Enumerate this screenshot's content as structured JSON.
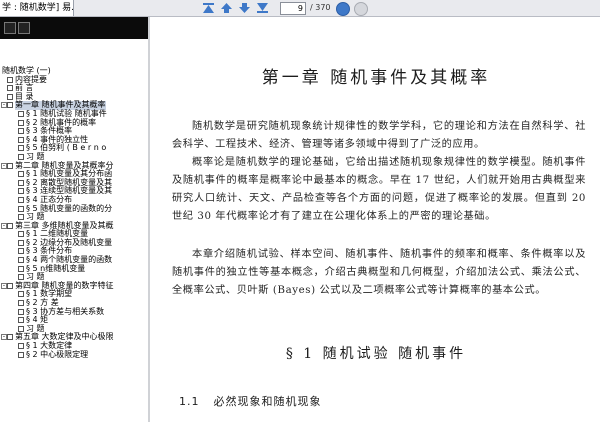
{
  "toolbar": {
    "tab_title": "学 : 随机数学] 易...",
    "current_page": "9",
    "total_pages": "/ 370",
    "buttons": [
      "first-page-icon",
      "prev-page-icon",
      "next-page-icon",
      "last-page-icon"
    ],
    "accent": "#3e78c8"
  },
  "outline": {
    "root": "随机数学 (一)",
    "items": [
      {
        "label": "内容提要",
        "level": 1
      },
      {
        "label": "前      言",
        "level": 1
      },
      {
        "label": "目      录",
        "level": 1
      },
      {
        "label": "第一章  随机事件及其概率",
        "level": 1,
        "expander": true,
        "selected": true
      },
      {
        "label": "§ 1    随机试验   随机事件",
        "level": 2
      },
      {
        "label": "§ 2    随机事件的概率",
        "level": 2
      },
      {
        "label": "§ 3    条件概率",
        "level": 2
      },
      {
        "label": "§ 4    事件的独立性",
        "level": 2
      },
      {
        "label": "§ 5    伯努利 ( B e r n o",
        "level": 2
      },
      {
        "label": "习    题",
        "level": 2
      },
      {
        "label": "第二章  随机变量及其概率分",
        "level": 1,
        "expander": true
      },
      {
        "label": "§ 1    随机变量及其分布函",
        "level": 2
      },
      {
        "label": "§ 2    离散型随机变量及其",
        "level": 2
      },
      {
        "label": "§ 3    连续型随机变量及其",
        "level": 2
      },
      {
        "label": "§ 4    正态分布",
        "level": 2
      },
      {
        "label": "§ 5    随机变量的函数的分",
        "level": 2
      },
      {
        "label": "习    题",
        "level": 2
      },
      {
        "label": "第三章  多维随机变量及其概",
        "level": 1,
        "expander": true
      },
      {
        "label": "§ 1    二维随机变量",
        "level": 2
      },
      {
        "label": "§ 2    边缘分布及随机变量",
        "level": 2
      },
      {
        "label": "§ 3    条件分布",
        "level": 2
      },
      {
        "label": "§ 4    两个随机变量的函数",
        "level": 2
      },
      {
        "label": "§ 5    n维随机变量",
        "level": 2
      },
      {
        "label": "习    题",
        "level": 2
      },
      {
        "label": "第四章  随机变量的数字特征",
        "level": 1,
        "expander": true
      },
      {
        "label": "§ 1    数学期望",
        "level": 2
      },
      {
        "label": "§ 2    方      差",
        "level": 2
      },
      {
        "label": "§ 3    协方差与相关系数",
        "level": 2
      },
      {
        "label": "§ 4    矩",
        "level": 2
      },
      {
        "label": "习    题",
        "level": 2
      },
      {
        "label": "第五章  大数定律及中心极限",
        "level": 1,
        "expander": true
      },
      {
        "label": "§ 1    大数定律",
        "level": 2
      },
      {
        "label": "§ 2    中心极限定理",
        "level": 2
      }
    ]
  },
  "document": {
    "chapter_title": "第一章    随机事件及其概率",
    "paragraphs": [
      "随机数学是研究随机现象统计规律性的数学学科，它的理论和方法在自然科学、社会科学、工程技术、经济、管理等诸多领域中得到了广泛的应用。",
      "概率论是随机数学的理论基础，它给出描述随机现象规律性的数学模型。随机事件及随机事件的概率是概率论中最基本的概念。早在 17 世纪，人们就开始用古典概型来研究人口统计、天文、产品检查等各个方面的问题，促进了概率论的发展。但直到 20 世纪 30 年代概率论才有了建立在公理化体系上的严密的理论基础。",
      "本章介绍随机试验、样本空间、随机事件、随机事件的频率和概率、条件概率以及随机事件的独立性等基本概念，介绍古典概型和几何概型，介绍加法公式、乘法公式、全概率公式、贝叶斯 (Bayes) 公式以及二项概率公式等计算概率的基本公式。"
    ],
    "section_title": "§ 1    随机试验    随机事件",
    "subsection_number": "1.1",
    "subsection_title": "必然现象和随机现象"
  }
}
